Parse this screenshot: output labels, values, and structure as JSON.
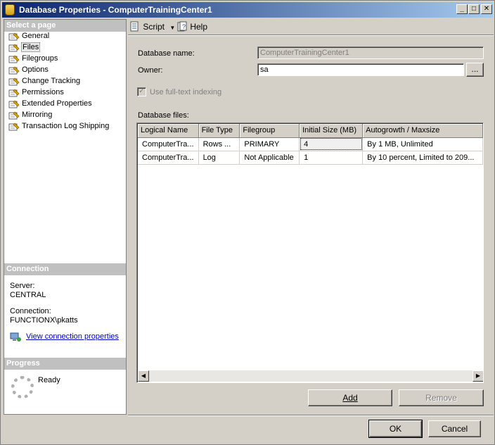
{
  "window": {
    "title": "Database Properties - ComputerTrainingCenter1",
    "minimize": "_",
    "maximize": "□",
    "close": "✕"
  },
  "select_page": {
    "header": "Select a page",
    "items": [
      {
        "label": "General"
      },
      {
        "label": "Files",
        "selected": true
      },
      {
        "label": "Filegroups"
      },
      {
        "label": "Options"
      },
      {
        "label": "Change Tracking"
      },
      {
        "label": "Permissions"
      },
      {
        "label": "Extended Properties"
      },
      {
        "label": "Mirroring"
      },
      {
        "label": "Transaction Log Shipping"
      }
    ]
  },
  "connection": {
    "header": "Connection",
    "server_label": "Server:",
    "server_value": "CENTRAL",
    "connection_label": "Connection:",
    "connection_value": "FUNCTIONX\\pkatts",
    "view_link": "View connection properties"
  },
  "progress": {
    "header": "Progress",
    "status": "Ready"
  },
  "toolbar": {
    "script_label": "Script",
    "help_label": "Help"
  },
  "form": {
    "database_name_label": "Database name:",
    "database_name_value": "ComputerTrainingCenter1",
    "owner_label": "Owner:",
    "owner_value": "sa",
    "owner_browse": "...",
    "fulltext_label": "Use full-text indexing",
    "fulltext_checked": true,
    "database_files_label": "Database files:"
  },
  "files_grid": {
    "columns": [
      "Logical Name",
      "File Type",
      "Filegroup",
      "Initial Size (MB)",
      "Autogrowth / Maxsize"
    ],
    "rows": [
      [
        "ComputerTra...",
        "Rows ...",
        "PRIMARY",
        "4",
        "By 1 MB, Unlimited"
      ],
      [
        "ComputerTra...",
        "Log",
        "Not Applicable",
        "1",
        "By 10 percent, Limited to 209..."
      ]
    ]
  },
  "buttons": {
    "add": "Add",
    "remove": "Remove",
    "ok": "OK",
    "cancel": "Cancel"
  },
  "colors": {
    "titlebar_start": "#0a246a",
    "titlebar_end": "#a6caf0",
    "dialog_bg": "#d4d0c8",
    "section_header": "#c0c0c0",
    "link": "#0000cc"
  }
}
